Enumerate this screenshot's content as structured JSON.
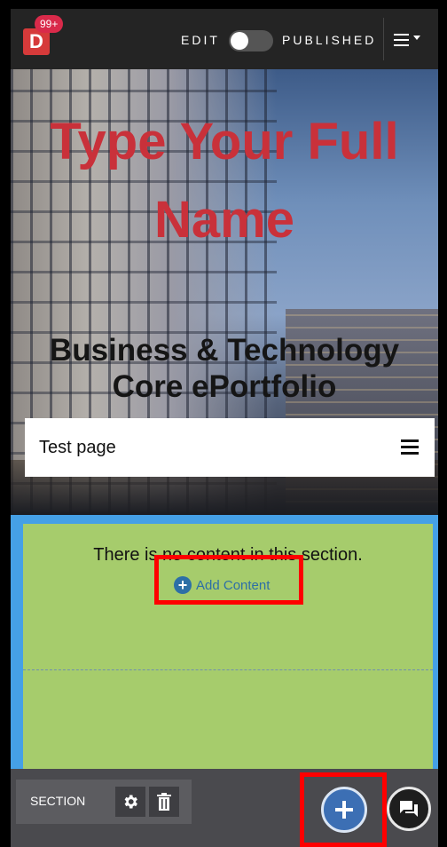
{
  "topbar": {
    "logo_letter": "D",
    "notification_count": "99+",
    "edit_label": "EDIT",
    "published_label": "PUBLISHED",
    "menu_icon": "hamburger-menu-icon"
  },
  "hero": {
    "name": "Type Your Full Name",
    "subtitle": "Business & Technology Core ePortfolio"
  },
  "page_nav": {
    "title": "Test page",
    "menu_icon": "hamburger-icon"
  },
  "section": {
    "empty_message": "There is no content in this section.",
    "add_content_label": "Add Content"
  },
  "footer": {
    "section_label": "SECTION",
    "settings_icon": "gear-icon",
    "delete_icon": "trash-icon",
    "add_icon": "plus-icon",
    "chat_icon": "chat-icon"
  },
  "colors": {
    "name_red": "#c9313a",
    "section_green": "#a6cc6c",
    "section_blue": "#45a0e6",
    "fab_blue": "#3c6fb4",
    "highlight_red": "#ff0000"
  }
}
